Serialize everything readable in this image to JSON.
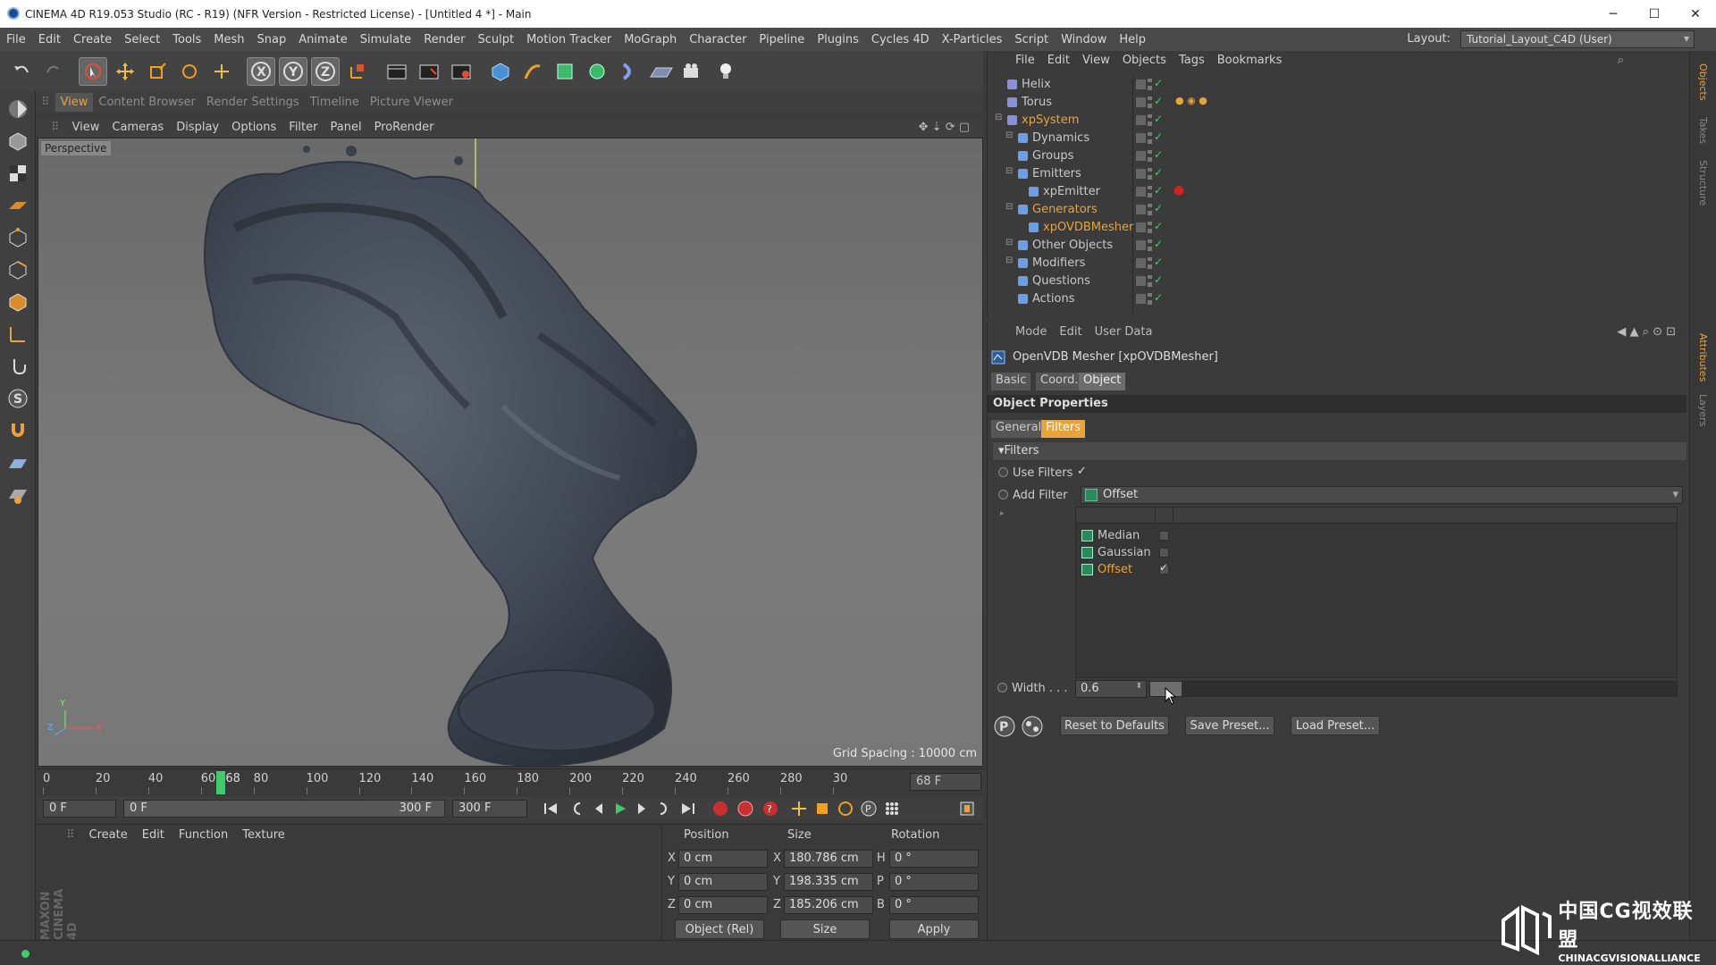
{
  "window": {
    "title": "CINEMA 4D R19.053 Studio (RC - R19) (NFR Version - Restricted License) - [Untitled 4 *] - Main",
    "minimize": "─",
    "maximize": "☐",
    "close": "✕"
  },
  "menu": [
    "File",
    "Edit",
    "Create",
    "Select",
    "Tools",
    "Mesh",
    "Snap",
    "Animate",
    "Simulate",
    "Render",
    "Sculpt",
    "Motion Tracker",
    "MoGraph",
    "Character",
    "Pipeline",
    "Plugins",
    "Cycles 4D",
    "X-Particles",
    "Script",
    "Window",
    "Help"
  ],
  "layout": {
    "label": "Layout:",
    "value": "Tutorial_Layout_C4D (User)"
  },
  "toolbar": {
    "icons": [
      "undo-icon",
      "redo-icon",
      "select-cursor-icon",
      "move-icon",
      "scale-icon",
      "rotate-icon",
      "live-select-icon",
      "x-axis-icon",
      "y-axis-icon",
      "z-axis-icon",
      "coord-system-icon",
      "render-view-icon",
      "render-picture-icon",
      "render-settings-icon",
      "cube-icon",
      "pen-icon",
      "subdivision-icon",
      "cloner-icon",
      "deformer-icon",
      "floor-icon",
      "camera-icon",
      "light-icon"
    ],
    "axis": [
      "X",
      "Y",
      "Z"
    ]
  },
  "viewport_tabs": [
    {
      "label": "View",
      "active": true
    },
    {
      "label": "Content Browser",
      "active": false
    },
    {
      "label": "Render Settings",
      "active": false
    },
    {
      "label": "Timeline",
      "active": false
    },
    {
      "label": "Picture Viewer",
      "active": false
    }
  ],
  "viewport_menu": [
    "View",
    "Cameras",
    "Display",
    "Options",
    "Filter",
    "Panel",
    "ProRender"
  ],
  "viewport": {
    "label": "Perspective",
    "grid_spacing": "Grid Spacing : 10000 cm",
    "axis_y": "Y",
    "axis_z": "Z",
    "axis_x": "X"
  },
  "timeline": {
    "ticks": [
      "0",
      "20",
      "40",
      "60",
      "68",
      "80",
      "100",
      "120",
      "140",
      "160",
      "180",
      "200",
      "220",
      "240",
      "260",
      "280",
      "30"
    ],
    "current_frame": 68,
    "frame_display": "68 F"
  },
  "transport": {
    "start": "0 F",
    "range_start": "0 F",
    "range_end": "300 F",
    "end": "300 F"
  },
  "material_menu": [
    "Create",
    "Edit",
    "Function",
    "Texture"
  ],
  "coords": {
    "headers": [
      "Position",
      "Size",
      "Rotation"
    ],
    "rows": [
      {
        "axis": "X",
        "pos": "0 cm",
        "size_axis": "X",
        "size": "180.786 cm",
        "rot_axis": "H",
        "rot": "0 °"
      },
      {
        "axis": "Y",
        "pos": "0 cm",
        "size_axis": "Y",
        "size": "198.335 cm",
        "rot_axis": "P",
        "rot": "0 °"
      },
      {
        "axis": "Z",
        "pos": "0 cm",
        "size_axis": "Z",
        "size": "185.206 cm",
        "rot_axis": "B",
        "rot": "0 °"
      }
    ],
    "mode": "Object (Rel)",
    "size_mode": "Size",
    "apply": "Apply"
  },
  "object_menu": [
    "File",
    "Edit",
    "View",
    "Objects",
    "Tags",
    "Bookmarks"
  ],
  "objects": [
    {
      "name": "Helix",
      "indent": 0,
      "color": "#c8c8c8"
    },
    {
      "name": "Torus",
      "indent": 0,
      "color": "#c8c8c8"
    },
    {
      "name": "xpSystem",
      "indent": 0,
      "color": "#e8a33c"
    },
    {
      "name": "Dynamics",
      "indent": 1,
      "color": "#c8c8c8"
    },
    {
      "name": "Groups",
      "indent": 1,
      "color": "#c8c8c8"
    },
    {
      "name": "Emitters",
      "indent": 1,
      "color": "#c8c8c8"
    },
    {
      "name": "xpEmitter",
      "indent": 2,
      "color": "#c8c8c8"
    },
    {
      "name": "Generators",
      "indent": 1,
      "color": "#e8a33c"
    },
    {
      "name": "xpOVDBMesher",
      "indent": 2,
      "color": "#e8a33c"
    },
    {
      "name": "Other Objects",
      "indent": 1,
      "color": "#c8c8c8"
    },
    {
      "name": "Modifiers",
      "indent": 1,
      "color": "#c8c8c8"
    },
    {
      "name": "Questions",
      "indent": 1,
      "color": "#c8c8c8"
    },
    {
      "name": "Actions",
      "indent": 1,
      "color": "#c8c8c8"
    }
  ],
  "attr": {
    "menu": [
      "Mode",
      "Edit",
      "User Data"
    ],
    "title": "OpenVDB Mesher [xpOVDBMesher]",
    "tabs": [
      {
        "label": "Basic",
        "sel": false
      },
      {
        "label": "Coord.",
        "sel": false
      },
      {
        "label": "Object",
        "sel": true
      }
    ],
    "section": "Object Properties",
    "subtabs": [
      {
        "label": "General",
        "sel": false
      },
      {
        "label": "Filters",
        "sel": true
      }
    ],
    "group": "Filters",
    "use_filters": "Use Filters",
    "use_filters_check": "✓",
    "add_filter": "Add Filter",
    "add_filter_value": "Offset",
    "filters": [
      {
        "name": "Median",
        "checked": "",
        "color": "#c8c8c8"
      },
      {
        "name": "Gaussian",
        "checked": "",
        "color": "#c8c8c8"
      },
      {
        "name": "Offset",
        "checked": "✓",
        "color": "#e8a33c"
      }
    ],
    "width_label": "Width . . .",
    "width_value": "0.6",
    "width_fraction": 0.06,
    "reset": "Reset to Defaults",
    "save": "Save Preset...",
    "load": "Load Preset..."
  },
  "side_tabs": [
    "Objects",
    "Takes",
    "Structure",
    "Attributes",
    "Layers"
  ],
  "brand": {
    "vertical": "MAXON CINEMA 4D",
    "wm_cn": "中国CG视效联盟",
    "wm_en": "CHINACGVISIONALLIANCE"
  },
  "colors": {
    "accent": "#e8a33c",
    "playhead": "#3ecb6a"
  }
}
